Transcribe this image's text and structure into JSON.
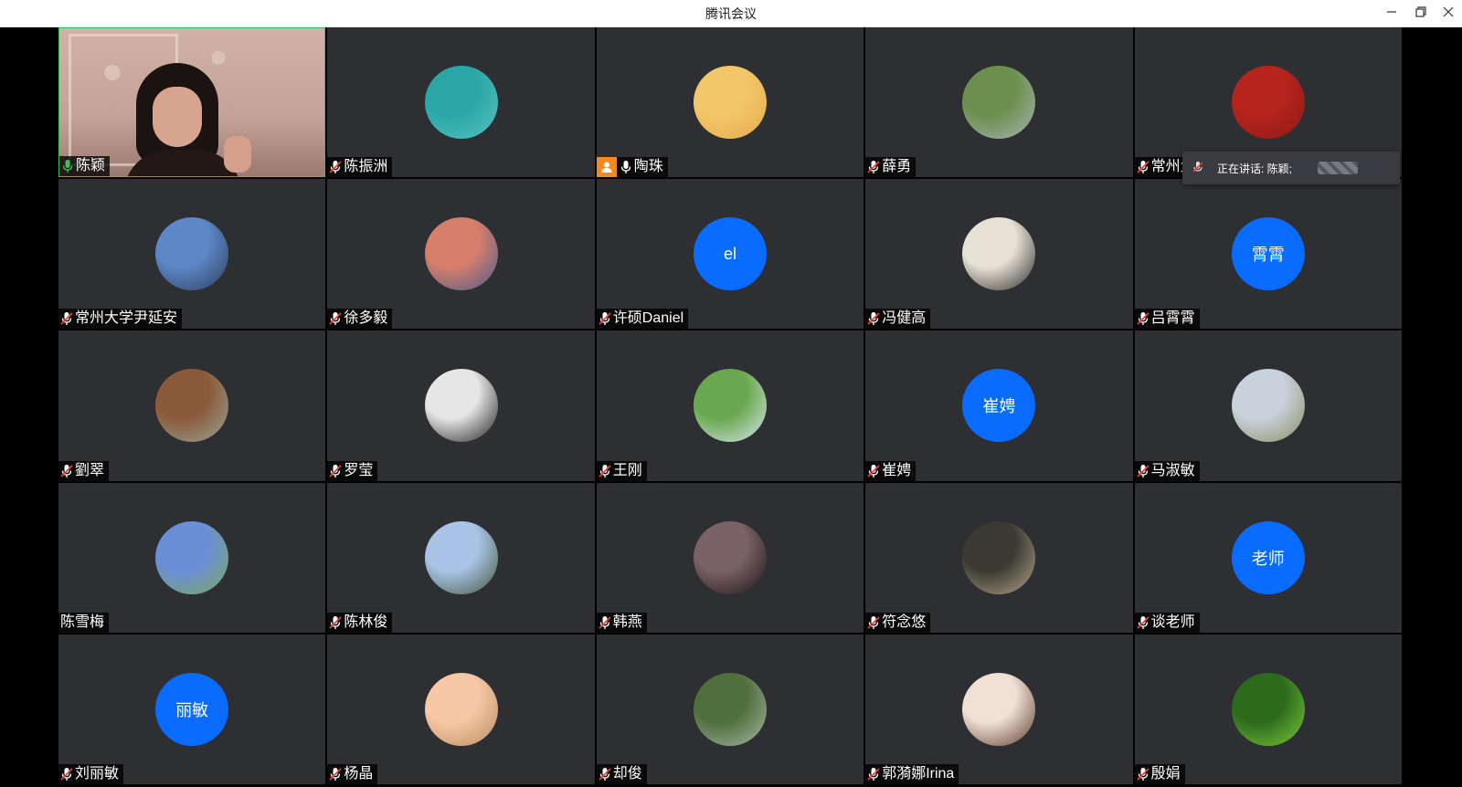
{
  "window": {
    "title": "腾讯会议",
    "controls": {
      "minimize_icon": "minimize-icon",
      "restore_icon": "restore-icon",
      "close_icon": "close-icon"
    }
  },
  "participants": [
    {
      "name": "陈颖",
      "avatar": "video",
      "mic": "active"
    },
    {
      "name": "陈振洲",
      "avatar": "image",
      "colors": [
        "#2aa6a6",
        "#58c3c3"
      ],
      "mic": "muted"
    },
    {
      "name": "陶珠",
      "avatar": "image",
      "colors": [
        "#f2c76a",
        "#e7a84a"
      ],
      "mic": "on",
      "host": true
    },
    {
      "name": "薛勇",
      "avatar": "image",
      "colors": [
        "#6c8f4e",
        "#a6b4b4"
      ],
      "mic": "muted"
    },
    {
      "name": "常州大学",
      "avatar": "image",
      "colors": [
        "#b5241d",
        "#8c1a16"
      ],
      "mic": "muted"
    },
    {
      "name": "常州大学尹延安",
      "avatar": "image",
      "colors": [
        "#5d87c6",
        "#2c3f5c"
      ],
      "mic": "muted"
    },
    {
      "name": "徐多毅",
      "avatar": "image",
      "colors": [
        "#d87f6b",
        "#4a5b8c"
      ],
      "mic": "muted"
    },
    {
      "name": "许硕Daniel",
      "avatar": "text",
      "text": "el",
      "mic": "muted"
    },
    {
      "name": "冯健高",
      "avatar": "image",
      "colors": [
        "#e8e2d6",
        "#2a2a2a"
      ],
      "mic": "muted"
    },
    {
      "name": "吕霄霄",
      "avatar": "text",
      "text": "霄霄",
      "mic": "muted"
    },
    {
      "name": "劉翠",
      "avatar": "image",
      "colors": [
        "#8a5a3a",
        "#9aa59a"
      ],
      "mic": "muted"
    },
    {
      "name": "罗莹",
      "avatar": "image",
      "colors": [
        "#e6e6e6",
        "#1a1a1a"
      ],
      "mic": "muted"
    },
    {
      "name": "王刚",
      "avatar": "image",
      "colors": [
        "#6aa84f",
        "#d9e8f0"
      ],
      "mic": "muted"
    },
    {
      "name": "崔娉",
      "avatar": "text",
      "text": "崔娉",
      "mic": "muted"
    },
    {
      "name": "马淑敏",
      "avatar": "image",
      "colors": [
        "#c8d2dc",
        "#8a8f62"
      ],
      "mic": "muted"
    },
    {
      "name": "陈雪梅",
      "avatar": "image",
      "colors": [
        "#6a8fd6",
        "#7ca860"
      ],
      "mic": "none"
    },
    {
      "name": "陈林俊",
      "avatar": "image",
      "colors": [
        "#a9c4e6",
        "#44553a"
      ],
      "mic": "muted"
    },
    {
      "name": "韩燕",
      "avatar": "image",
      "colors": [
        "#7a6266",
        "#1a1416"
      ],
      "mic": "muted"
    },
    {
      "name": "符念悠",
      "avatar": "image",
      "colors": [
        "#3a3a32",
        "#b7a48a"
      ],
      "mic": "muted"
    },
    {
      "name": "谈老师",
      "avatar": "text",
      "text": "老师",
      "mic": "muted"
    },
    {
      "name": "刘丽敏",
      "avatar": "text",
      "text": "丽敏",
      "mic": "muted"
    },
    {
      "name": "杨晶",
      "avatar": "image",
      "colors": [
        "#f7c8a6",
        "#b98b5c"
      ],
      "mic": "muted"
    },
    {
      "name": "却俊",
      "avatar": "image",
      "colors": [
        "#4f6f3c",
        "#a8b8a8"
      ],
      "mic": "muted"
    },
    {
      "name": "郭漪娜Irina",
      "avatar": "image",
      "colors": [
        "#f0e0d6",
        "#5c3a2a"
      ],
      "mic": "muted"
    },
    {
      "name": "殷娟",
      "avatar": "image",
      "colors": [
        "#2c6a1c",
        "#7acb3c"
      ],
      "mic": "muted"
    }
  ],
  "speaking_toast": {
    "label": "正在讲话: 陈颖;",
    "icon": "muted-mic-icon"
  },
  "colors": {
    "accent_blue": "#0a6cff",
    "active_speaker_border": "#3fbf5a",
    "tile_bg": "#2e2f33",
    "mic_active": "#3fbf5a",
    "mic_muted": "#e0413b"
  }
}
